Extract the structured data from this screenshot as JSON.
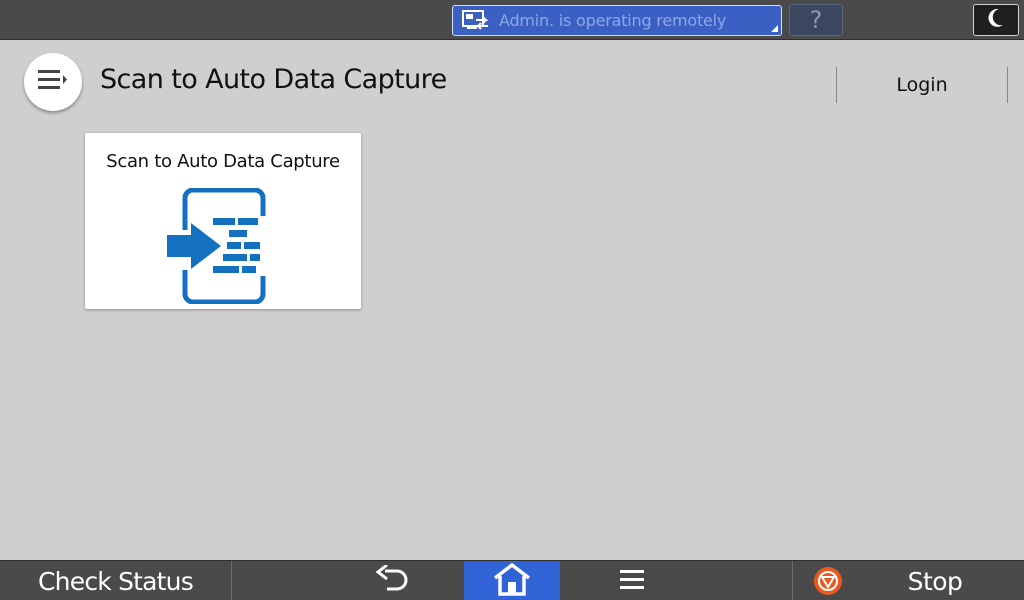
{
  "statusbar": {
    "remote_status_text": "Admin. is operating remotely",
    "help_label": "?",
    "remote_icon": "remote-operation-icon",
    "energy_icon": "moon-icon"
  },
  "header": {
    "title": "Scan to Auto Data Capture",
    "login_label": "Login",
    "menu_icon": "menu-icon"
  },
  "tiles": [
    {
      "label": "Scan to Auto Data Capture",
      "icon": "scan-to-data-capture-icon"
    }
  ],
  "bottombar": {
    "check_status_label": "Check Status",
    "stop_label": "Stop",
    "back_icon": "back-arrow-icon",
    "home_icon": "home-icon",
    "list_icon": "list-icon",
    "stop_icon": "stop-icon"
  },
  "colors": {
    "background": "#cfcfcf",
    "bar": "#4a4a4a",
    "accent_blue": "#2f63d6",
    "tile_icon_blue": "#1470c0",
    "remote_status_bg": "#3a60c4",
    "stop_orange": "#ea5a1e"
  }
}
